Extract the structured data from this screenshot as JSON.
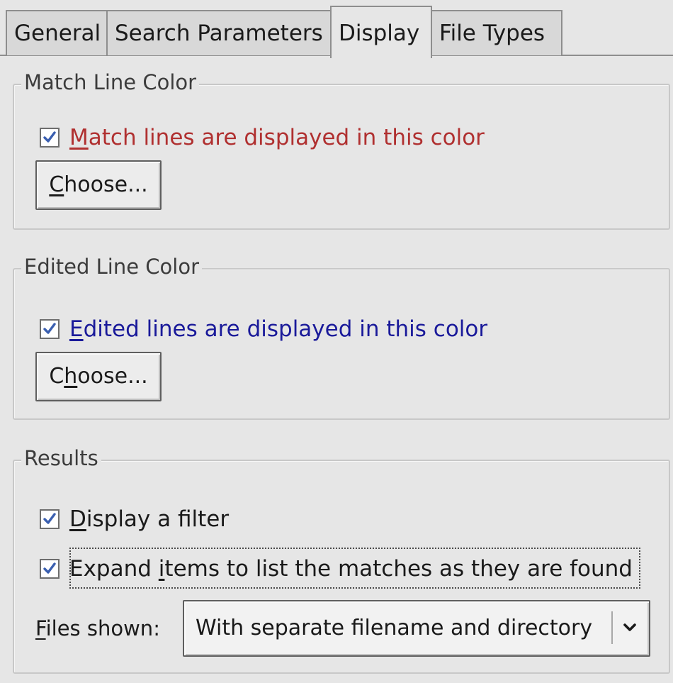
{
  "tabs": [
    {
      "label": "General",
      "active": false
    },
    {
      "label": "Search Parameters",
      "active": false
    },
    {
      "label": "Display",
      "active": true
    },
    {
      "label": "File Types",
      "active": false
    }
  ],
  "match_group": {
    "title": "Match Line Color",
    "checkbox": {
      "checked": true,
      "mnemonic": "M",
      "rest": "atch lines are displayed in this color",
      "color": "#b03030"
    },
    "button": {
      "pre": "",
      "mnemonic": "C",
      "post": "hoose..."
    }
  },
  "edited_group": {
    "title": "Edited Line Color",
    "checkbox": {
      "checked": true,
      "mnemonic": "E",
      "rest": "dited lines are displayed in this color",
      "color": "#1a1a9a"
    },
    "button": {
      "pre": "C",
      "mnemonic": "h",
      "post": "oose..."
    }
  },
  "results_group": {
    "title": "Results",
    "display_filter": {
      "checked": true,
      "mnemonic": "D",
      "rest": "isplay a filter"
    },
    "expand_items": {
      "checked": true,
      "pre": "Expand ",
      "mnemonic": "i",
      "rest": "tems to list the matches as they are found"
    },
    "files_shown": {
      "mnemonic": "F",
      "rest": "iles shown:",
      "value": "With separate filename and directory"
    }
  },
  "icons": {
    "checkmark": "checkmark-icon",
    "dropdown": "chevron-down-icon"
  },
  "colors": {
    "background": "#e6e6e6",
    "checkmark": "#3a5fb0"
  }
}
